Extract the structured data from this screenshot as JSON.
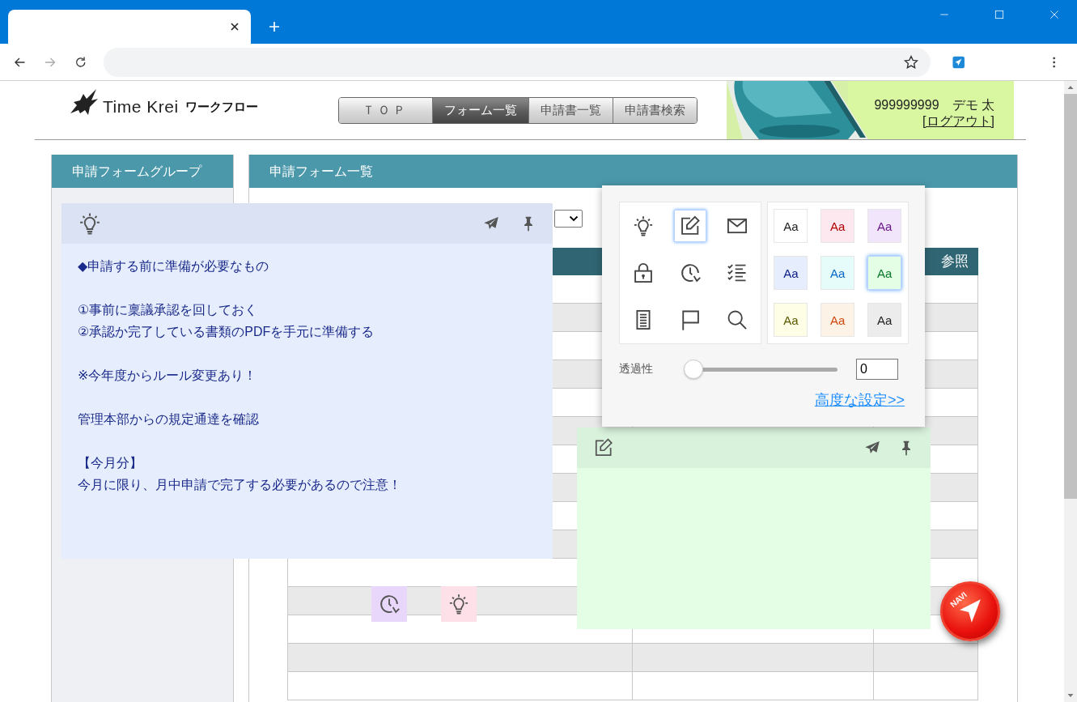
{
  "browser": {
    "tab": {
      "selected": true
    }
  },
  "header": {
    "logo_brand": "Time Krei",
    "logo_product": "ワークフロー",
    "nav": [
      {
        "label": "ＴＯＰ",
        "selected": false
      },
      {
        "label": "フォーム一覧",
        "selected": true
      },
      {
        "label": "申請書一覧",
        "selected": false
      },
      {
        "label": "申請書検索",
        "selected": false
      }
    ],
    "user": "999999999　デモ 太",
    "logout": "[ログアウト]"
  },
  "sidebar": {
    "title": "申請フォームグループ"
  },
  "main": {
    "title": "申請フォーム一覧",
    "table": {
      "column_3": "参照"
    }
  },
  "notes": [
    {
      "kind": "bulb",
      "color": "#e6edfd",
      "paragraphs": [
        [
          "◆申請する前に準備が必要なもの"
        ],
        [
          "①事前に稟議承認を回しておく",
          "②承認か完了している書類のPDFを手元に準備する"
        ],
        [
          "※今年度からルール変更あり！"
        ],
        [
          "管理本部からの規定通達を確認"
        ],
        [
          "【今月分】",
          "今月に限り、月中申請で完了する必要があるので注意！"
        ]
      ]
    },
    {
      "kind": "pencil",
      "color": "#e4fde5"
    }
  ],
  "settings_popup": {
    "icons": [
      {
        "kind": "bulb",
        "selected": false
      },
      {
        "kind": "pencil",
        "selected": true
      },
      {
        "kind": "mail",
        "selected": false
      },
      {
        "kind": "lock",
        "selected": false
      },
      {
        "kind": "clock",
        "selected": false
      },
      {
        "kind": "checklist",
        "selected": false
      },
      {
        "kind": "document",
        "selected": false
      },
      {
        "kind": "flag",
        "selected": false
      },
      {
        "kind": "search",
        "selected": false
      }
    ],
    "themes": [
      {
        "label": "Aa",
        "color": "#ffffff",
        "selected": false
      },
      {
        "label": "Aa",
        "color": "#fde8ef",
        "selected": false
      },
      {
        "label": "Aa",
        "color": "#f1e5fc",
        "selected": false
      },
      {
        "label": "Aa",
        "color": "#e6edfd",
        "selected": false
      },
      {
        "label": "Aa",
        "color": "#e5fcfb",
        "selected": false
      },
      {
        "label": "Aa",
        "color": "#e4fde5",
        "selected": true
      },
      {
        "label": "Aa",
        "color": "#fefee6",
        "selected": false
      },
      {
        "label": "Aa",
        "color": "#fdf2e6",
        "selected": false
      },
      {
        "label": "Aa",
        "color": "#ececec",
        "selected": false
      }
    ],
    "opacity_label": "透過性",
    "opacity": {
      "level": 0
    },
    "opacity_value": "0",
    "advanced_link": "高度な設定>>"
  },
  "minimized_notes": [
    {
      "kind": "clock",
      "color": "#e8d7fb"
    },
    {
      "kind": "bulb",
      "color": "#fde0e8"
    }
  ],
  "navi_button": {
    "label": "NAVI"
  }
}
